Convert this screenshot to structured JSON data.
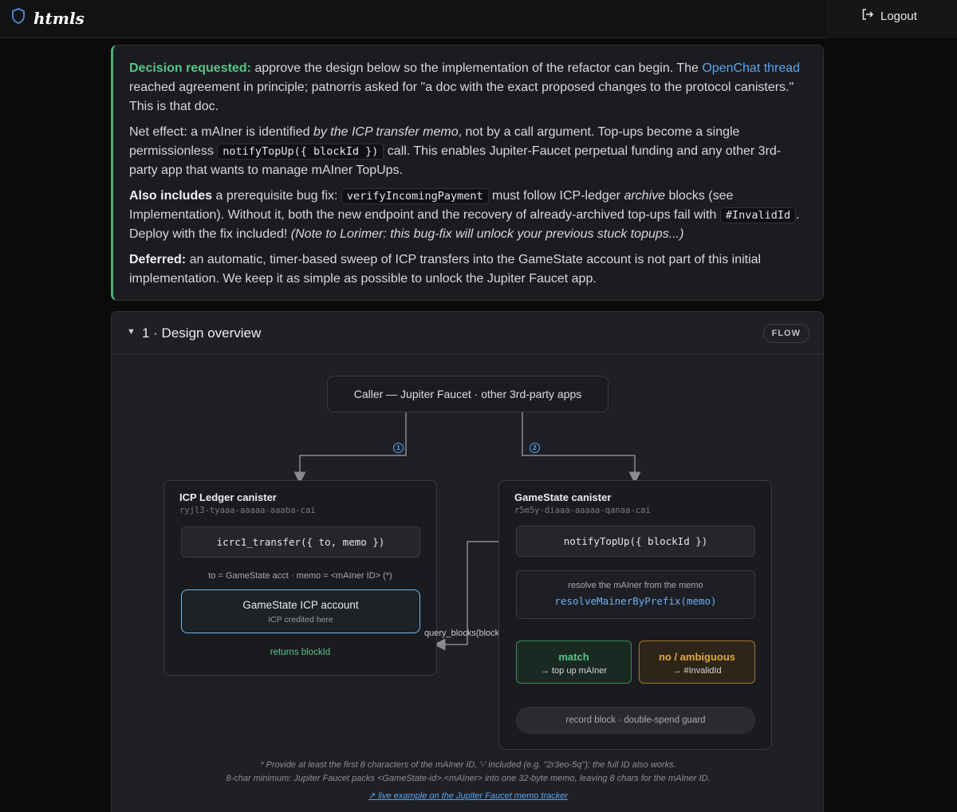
{
  "app": {
    "brand": "htmls",
    "logout_label": "Logout"
  },
  "callout": {
    "p1": {
      "lead": "Decision requested:",
      "t1": " approve the design below so the implementation of the refactor can begin. The ",
      "link": "OpenChat thread",
      "t2": " reached agreement in principle; patnorris asked for \"a doc with the exact proposed changes to the protocol canisters.\" This is that doc."
    },
    "p2": {
      "t1": "Net effect: a mAIner is identified ",
      "em": "by the ICP transfer memo",
      "t2": ", not by a call argument. Top-ups become a single permissionless ",
      "code": "notifyTopUp({ blockId })",
      "t3": " call. This enables Jupiter-Faucet perpetual funding and any other 3rd-party app that wants to manage mAIner TopUps."
    },
    "p3": {
      "lead": "Also includes",
      "t1": " a prerequisite bug fix: ",
      "code1": "verifyIncomingPayment",
      "t2": " must follow ICP-ledger ",
      "em": "archive",
      "t3": " blocks (see Implementation). Without it, both the new endpoint and the recovery of already-archived top-ups fail with ",
      "code2": "#InvalidId",
      "t4": ". Deploy with the fix included! ",
      "note": "(Note to Lorimer: this bug-fix will unlock your previous stuck topups...)"
    },
    "p4": {
      "lead": "Deferred:",
      "t1": " an automatic, timer-based sweep of ICP transfers into the GameState account is not part of this initial implementation. We keep it as simple as possible to unlock the Jupiter Faucet app."
    }
  },
  "section": {
    "title": "1 · Design overview",
    "badge": "FLOW",
    "caller": "Caller — Jupiter Faucet · other 3rd-party apps",
    "step1": "1",
    "step2": "2",
    "ledger": {
      "title": "ICP Ledger canister",
      "id": "ryjl3-tyaaa-aaaaa-aaaba-cai",
      "call": "icrc1_transfer({ to, memo })",
      "note": "to = GameState acct · memo = <mAIner ID> (*)",
      "account_title": "GameState ICP account",
      "account_sub": "ICP credited here",
      "returns": "returns blockId"
    },
    "gamestate": {
      "title": "GameState canister",
      "id": "r5m5y-diaaa-aaaaa-qanaa-cai",
      "call": "notifyTopUp({ blockId })",
      "resolve_label": "resolve the mAIner from the memo",
      "resolve_fn": "resolveMainerByPrefix(memo)",
      "match_title": "match",
      "match_sub": "→ top up mAIner",
      "nomatch_title": "no / ambiguous",
      "nomatch_sub": "→ #InvalidId",
      "record": "record block · double-spend guard"
    },
    "query_label": "query_blocks(blockId)",
    "footnote1": "* Provide at least the first 8 characters of the mAIner ID, '-' included (e.g. \"2r3eo-5q\"); the full ID also works.",
    "footnote2": "8-char minimum: Jupiter Faucet packs <GameState-id>.<mAIner> into one 32-byte memo, leaving 8 chars for the mAIner ID.",
    "footnote_link": "↗ live example on the Jupiter Faucet memo tracker"
  },
  "colors": {
    "accent_green": "#58c489",
    "link_blue": "#5aa6f0",
    "warn_amber": "#e0a93c"
  },
  "icons": {
    "brand": "shield-icon",
    "logout": "logout-icon",
    "caret": "caret-down-icon"
  }
}
